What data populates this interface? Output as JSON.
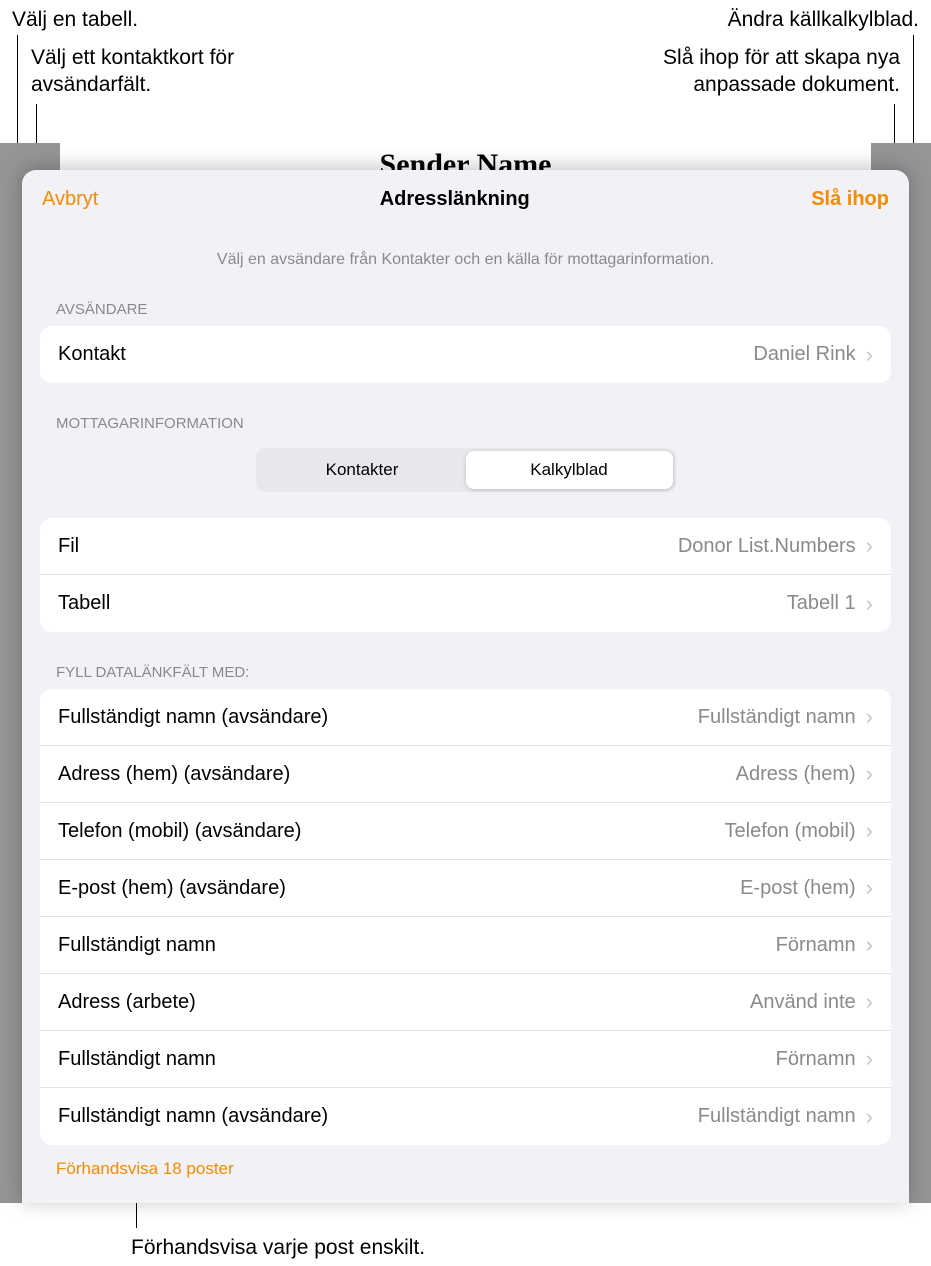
{
  "callouts": {
    "top_left": "Välj en tabell.",
    "top_right": "Ändra källkalkylblad.",
    "left2_line1": "Välj ett kontaktkort för",
    "left2_line2": "avsändarfält.",
    "right2_line1": "Slå ihop för att skapa nya",
    "right2_line2": "anpassade dokument.",
    "bottom": "Förhandsvisa varje post enskilt."
  },
  "document": {
    "title_behind": "Sender Name"
  },
  "sheet": {
    "cancel": "Avbryt",
    "title": "Adresslänkning",
    "merge": "Slå ihop",
    "subtitle": "Välj en avsändare från Kontakter och en källa för mottagarinformation."
  },
  "sections": {
    "sender": "Avsändare",
    "recipient": "Mottagarinformation",
    "populate": "Fyll datalänkfält med:"
  },
  "sender_row": {
    "label": "Kontakt",
    "value": "Daniel Rink"
  },
  "segmented": {
    "contacts": "Kontakter",
    "spreadsheet": "Kalkylblad"
  },
  "source_rows": {
    "file": {
      "label": "Fil",
      "value": "Donor List.Numbers"
    },
    "table": {
      "label": "Tabell",
      "value": "Tabell 1"
    }
  },
  "field_rows": [
    {
      "label": "Fullständigt namn (avsändare)",
      "value": "Fullständigt namn"
    },
    {
      "label": "Adress (hem) (avsändare)",
      "value": "Adress (hem)"
    },
    {
      "label": "Telefon (mobil) (avsändare)",
      "value": "Telefon (mobil)"
    },
    {
      "label": "E-post (hem) (avsändare)",
      "value": "E-post (hem)"
    },
    {
      "label": "Fullständigt namn",
      "value": "Förnamn"
    },
    {
      "label": "Adress (arbete)",
      "value": "Använd inte"
    },
    {
      "label": "Fullständigt namn",
      "value": "Förnamn"
    },
    {
      "label": "Fullständigt namn (avsändare)",
      "value": "Fullständigt namn"
    }
  ],
  "preview": "Förhandsvisa 18 poster"
}
